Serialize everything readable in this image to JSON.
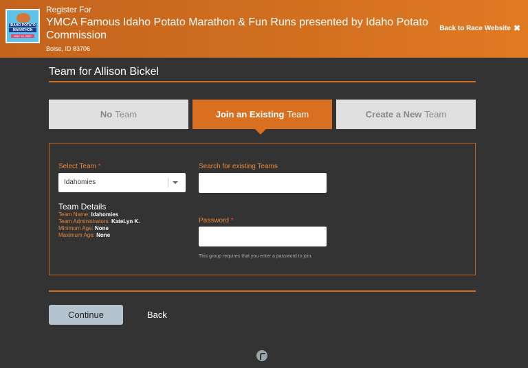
{
  "header": {
    "register_for": "Register For",
    "race_title": "YMCA Famous Idaho Potato Marathon & Fun Runs presented by Idaho Potato Commission",
    "location": "Boise, ID 83706",
    "back_link": "Back to Race Website",
    "logo": {
      "line1": "IDAHO POTATO",
      "line2": "MARATHON",
      "line3": "MAY 14, 2022"
    }
  },
  "page": {
    "team_heading": "Team for Allison Bickel"
  },
  "tabs": [
    {
      "bold": "No",
      "rest": "Team",
      "active": false
    },
    {
      "bold": "Join an Existing",
      "rest": "Team",
      "active": true
    },
    {
      "bold": "Create a New",
      "rest": "Team",
      "active": false
    }
  ],
  "form": {
    "select_team_label": "Select Team",
    "select_team_value": "Idahomies",
    "search_label": "Search for existing Teams",
    "search_value": "",
    "password_label": "Password",
    "password_value": "",
    "required_mark": "*",
    "password_hint": "This group requires that you enter a password to join."
  },
  "team_details": {
    "title": "Team Details",
    "rows": [
      {
        "label": "Team Name:",
        "value": "Idahomies"
      },
      {
        "label": "Team Administrators:",
        "value": "KateLyn K."
      },
      {
        "label": "Minimum Age:",
        "value": "None"
      },
      {
        "label": "Maximum Age:",
        "value": "None"
      }
    ]
  },
  "actions": {
    "continue": "Continue",
    "back": "Back"
  },
  "colors": {
    "accent": "#d97021",
    "background": "#333333",
    "label": "#e8873a"
  }
}
